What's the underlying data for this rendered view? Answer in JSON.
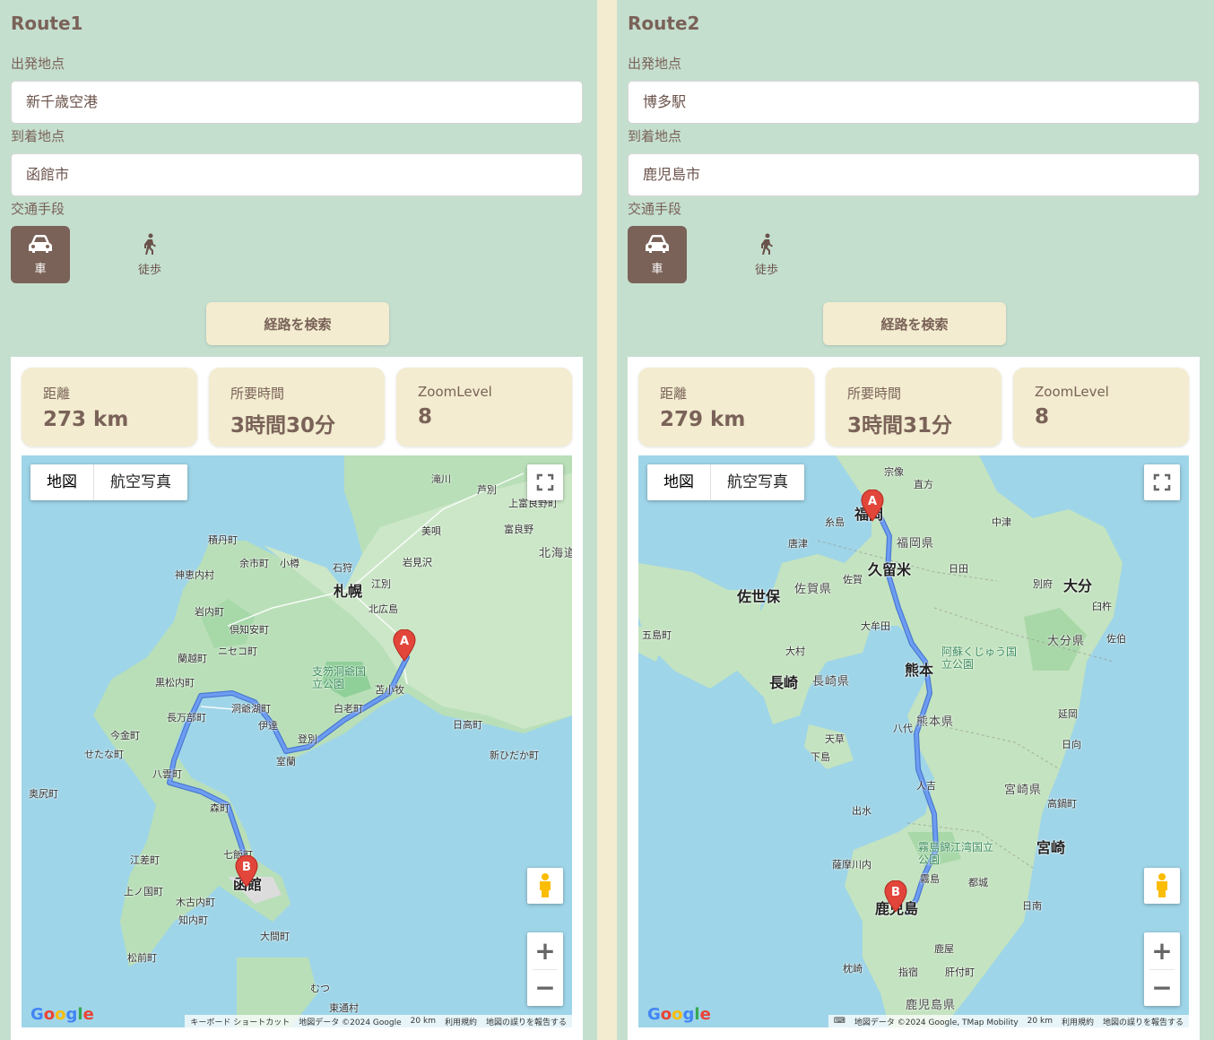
{
  "routes": [
    {
      "title": "Route1",
      "origin_label": "出発地点",
      "origin_value": "新千歳空港",
      "destination_label": "到着地点",
      "destination_value": "函館市",
      "mode_label": "交通手段",
      "modes": [
        {
          "label": "車",
          "icon": "car-icon",
          "active": true
        },
        {
          "label": "徒歩",
          "icon": "walk-icon",
          "active": false
        }
      ],
      "search_button": "経路を検索",
      "stats": [
        {
          "label": "距離",
          "value": "273 km"
        },
        {
          "label": "所要時間",
          "value": "3時間30分"
        },
        {
          "label": "ZoomLevel",
          "value": "8"
        }
      ],
      "map": {
        "type_buttons": [
          "地図",
          "航空写真"
        ],
        "attribution": [
          "キーボード ショートカット",
          "地図データ ©2024 Google",
          "20 km",
          "利用規約",
          "地図の誤りを報告する"
        ],
        "markers": [
          "A",
          "B"
        ],
        "places": [
          "滝川",
          "芦別",
          "上富良野町",
          "富良野",
          "美唄",
          "北海道",
          "積丹町",
          "余市町",
          "小樽",
          "石狩",
          "岩見沢",
          "神恵内村",
          "札幌",
          "江別",
          "北広島",
          "岩内町",
          "倶知安町",
          "ニセコ町",
          "蘭越町",
          "支笏洞爺国立公園",
          "黒松内町",
          "苫小牧",
          "長万部町",
          "洞爺湖町",
          "白老町",
          "伊達",
          "日高町",
          "今金町",
          "登別",
          "せたな町",
          "新ひだか町",
          "室蘭",
          "八雲町",
          "奥尻町",
          "森町",
          "七飯町",
          "江差町",
          "函館",
          "上ノ国町",
          "木古内町",
          "知内町",
          "大間町",
          "松前町",
          "むつ",
          "東通村"
        ]
      }
    },
    {
      "title": "Route2",
      "origin_label": "出発地点",
      "origin_value": "博多駅",
      "destination_label": "到着地点",
      "destination_value": "鹿児島市",
      "mode_label": "交通手段",
      "modes": [
        {
          "label": "車",
          "icon": "car-icon",
          "active": true
        },
        {
          "label": "徒歩",
          "icon": "walk-icon",
          "active": false
        }
      ],
      "search_button": "経路を検索",
      "stats": [
        {
          "label": "距離",
          "value": "279 km"
        },
        {
          "label": "所要時間",
          "value": "3時間31分"
        },
        {
          "label": "ZoomLevel",
          "value": "8"
        }
      ],
      "map": {
        "type_buttons": [
          "地図",
          "航空写真"
        ],
        "attribution": [
          "地図データ ©2024 Google, TMap Mobility",
          "20 km",
          "利用規約",
          "地図の誤りを報告する"
        ],
        "markers": [
          "A",
          "B"
        ],
        "places": [
          "宗像",
          "直方",
          "福岡",
          "糸島",
          "中津",
          "唐津",
          "福岡県",
          "久留米",
          "日田",
          "佐世保",
          "佐賀県",
          "佐賀",
          "別府",
          "大分",
          "臼杵",
          "五島町",
          "大牟田",
          "大分県",
          "佐伯",
          "大村",
          "阿蘇くじゅう国立公園",
          "熊本",
          "長崎",
          "長崎県",
          "八代",
          "熊本県",
          "延岡",
          "天草",
          "日向",
          "下島",
          "人吉",
          "宮崎県",
          "出水",
          "高鍋町",
          "霧島錦江湾国立公園",
          "宮崎",
          "薩摩川内",
          "霧島",
          "都城",
          "鹿児島",
          "日南",
          "鹿屋",
          "枕崎",
          "指宿",
          "肝付町",
          "鹿児島県"
        ]
      }
    }
  ],
  "colors": {
    "panel_bg": "#c5dfcf",
    "accent_brown": "#7a6258",
    "cream": "#f3ecd0",
    "route_blue": "#5b8def",
    "marker_red": "#e2463a"
  }
}
